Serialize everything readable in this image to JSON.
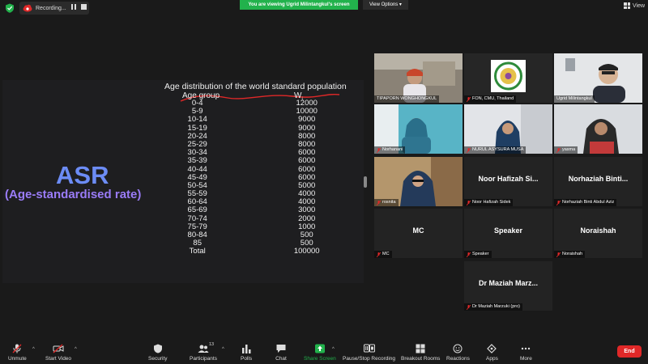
{
  "topbar": {
    "recording_label": "Recording...",
    "viewing_banner": "You are viewing Ugrid Milintangkul's screen",
    "view_options_label": "View Options",
    "view_label": "View"
  },
  "shared_screen": {
    "asr_title": "ASR",
    "asr_subtitle": "(Age-standardised rate)",
    "table_title": "Age distribution of the world standard population",
    "col_age": "Age group",
    "col_w": "W",
    "col_w_sub": "i",
    "rows": [
      {
        "age": "0-4",
        "w": "12000"
      },
      {
        "age": "5-9",
        "w": "10000"
      },
      {
        "age": "10-14",
        "w": "9000"
      },
      {
        "age": "15-19",
        "w": "9000"
      },
      {
        "age": "20-24",
        "w": "8000"
      },
      {
        "age": "25-29",
        "w": "8000"
      },
      {
        "age": "30-34",
        "w": "6000"
      },
      {
        "age": "35-39",
        "w": "6000"
      },
      {
        "age": "40-44",
        "w": "6000"
      },
      {
        "age": "45-49",
        "w": "6000"
      },
      {
        "age": "50-54",
        "w": "5000"
      },
      {
        "age": "55-59",
        "w": "4000"
      },
      {
        "age": "60-64",
        "w": "4000"
      },
      {
        "age": "65-69",
        "w": "3000"
      },
      {
        "age": "70-74",
        "w": "2000"
      },
      {
        "age": "75-79",
        "w": "1000"
      },
      {
        "age": "80-84",
        "w": "500"
      },
      {
        "age": "85",
        "w": "500"
      },
      {
        "age": "Total",
        "w": "100000"
      }
    ]
  },
  "participants": [
    {
      "name": "TIPAPORN WONGHONGKUL",
      "muted": false
    },
    {
      "name": "FON, CMU, Thailand",
      "muted": true
    },
    {
      "name": "Ugrid Milintangkul",
      "muted": false
    },
    {
      "name": "Norhanani",
      "muted": true
    },
    {
      "name": "NURUL ASYSURA MUSA",
      "muted": true
    },
    {
      "name": "yasma",
      "muted": true
    },
    {
      "name": "rosnita",
      "muted": true
    },
    {
      "name": "Noor Hafizah Sidek",
      "muted": true,
      "tile_name": "Noor Hafizah Si..."
    },
    {
      "name": "Norhaziah Binti Abdul Aziz",
      "muted": true,
      "tile_name": "Norhaziah Binti..."
    },
    {
      "name": "MC",
      "muted": true,
      "tile_name": "MC"
    },
    {
      "name": "Speaker",
      "muted": true,
      "tile_name": "Speaker"
    },
    {
      "name": "Noraishah",
      "muted": true,
      "tile_name": "Noraishah"
    },
    {
      "name": "Dr Maziah Marzuki (pro)",
      "muted": true,
      "tile_name": "Dr Maziah Marz..."
    }
  ],
  "toolbar": {
    "unmute": "Unmute",
    "start_video": "Start Video",
    "security": "Security",
    "participants": "Participants",
    "participants_count": "13",
    "polls": "Polls",
    "chat": "Chat",
    "share_screen": "Share Screen",
    "pause_stop": "Pause/Stop Recording",
    "breakout": "Breakout Rooms",
    "reactions": "Reactions",
    "apps": "Apps",
    "more": "More",
    "end": "End"
  },
  "colors": {
    "asr_blue": "#6c8cf5",
    "asr_purple": "#9a7cf7",
    "banner_green": "#22b24c",
    "active_speaker_border": "#d8e05a",
    "end_red": "#e02828",
    "share_green": "#22b24c"
  }
}
